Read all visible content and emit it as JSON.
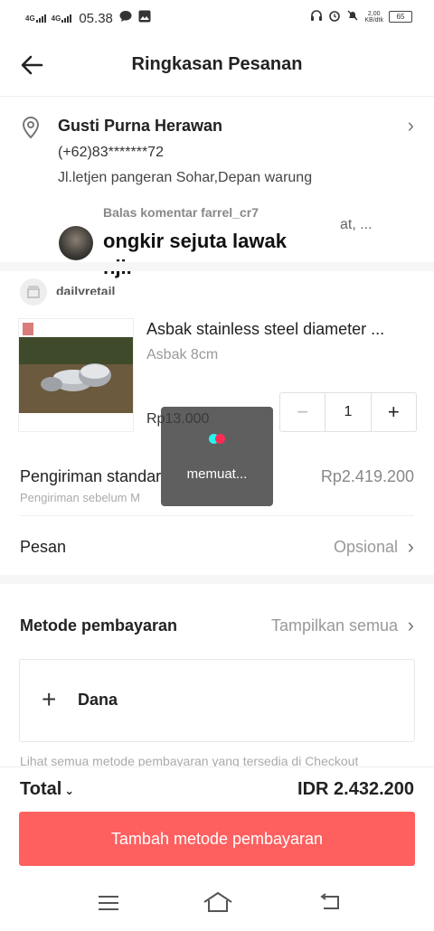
{
  "status_bar": {
    "sim1": "4G",
    "sim2": "4G",
    "time": "05.38",
    "net_speed_top": "2,00",
    "net_speed_bottom": "KB/dtk",
    "battery": "65"
  },
  "header": {
    "title": "Ringkasan Pesanan"
  },
  "address": {
    "name": "Gusti Purna Herawan",
    "phone": "(+62)83*******72",
    "street": "Jl.letjen pangeran Sohar,Depan warung",
    "street_suffix": "at, ..."
  },
  "comment_overlay": {
    "reply_to": "Balas komentar farrel_cr7",
    "text": "ongkir sejuta lawak njir"
  },
  "store": {
    "name": "dailyretail"
  },
  "product": {
    "title": "Asbak stainless steel diameter ...",
    "variant": "Asbak 8cm",
    "price": "Rp13.000",
    "quantity": "1",
    "minus": "−",
    "plus": "+"
  },
  "shipping": {
    "label": "Pengiriman standar",
    "sub": "Pengiriman sebelum M",
    "price": "Rp2.419.200"
  },
  "loading": {
    "text": "memuat..."
  },
  "message": {
    "label": "Pesan",
    "value": "Opsional"
  },
  "payment": {
    "label": "Metode pembayaran",
    "see_all": "Tampilkan semua",
    "option": "Dana",
    "note": "Lihat semua metode pembayaran yang tersedia di Checkout"
  },
  "footer": {
    "total_label": "Total",
    "total_value": "IDR 2.432.200",
    "cta": "Tambah metode pembayaran"
  },
  "colors": {
    "accent": "#fe5f5f",
    "muted": "#999999"
  }
}
